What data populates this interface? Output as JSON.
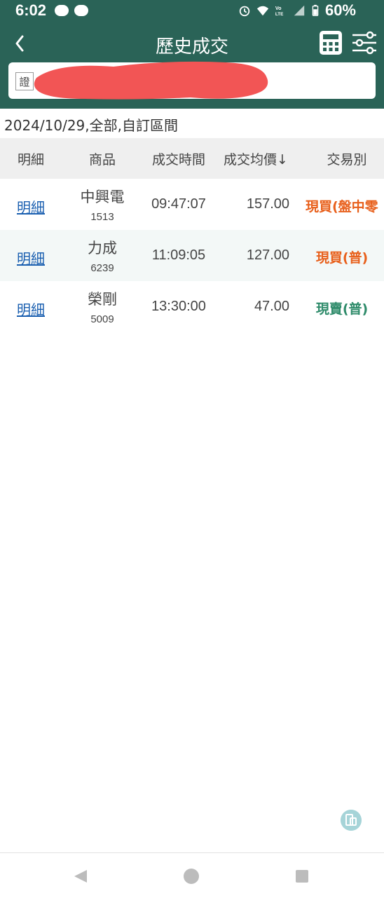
{
  "status_bar": {
    "time": "6:02",
    "battery": "60%"
  },
  "header": {
    "title": "歷史成交"
  },
  "account": {
    "tag": "證"
  },
  "filter_summary": "2024/10/29,全部,自訂區間",
  "table": {
    "columns": [
      "明細",
      "商品",
      "成交時間",
      "成交均價↓",
      "交易別"
    ],
    "rows": [
      {
        "detail": "明細",
        "name": "中興電",
        "code": "1513",
        "time": "09:47:07",
        "price": "157.00",
        "type": "現買(盤中零",
        "type_color": "#e8601c"
      },
      {
        "detail": "明細",
        "name": "力成",
        "code": "6239",
        "time": "11:09:05",
        "price": "127.00",
        "type": "現買(普)",
        "type_color": "#e8601c"
      },
      {
        "detail": "明細",
        "name": "榮剛",
        "code": "5009",
        "time": "13:30:00",
        "price": "47.00",
        "type": "現賣(普)",
        "type_color": "#2e8b6a"
      }
    ]
  },
  "colors": {
    "header_bg": "#2a6357",
    "link": "#1a5fb0",
    "buy": "#e8601c",
    "sell": "#2e8b6a"
  },
  "icons": [
    "back-icon",
    "calculator-icon",
    "filter-sliders-icon",
    "float-action-icon"
  ]
}
